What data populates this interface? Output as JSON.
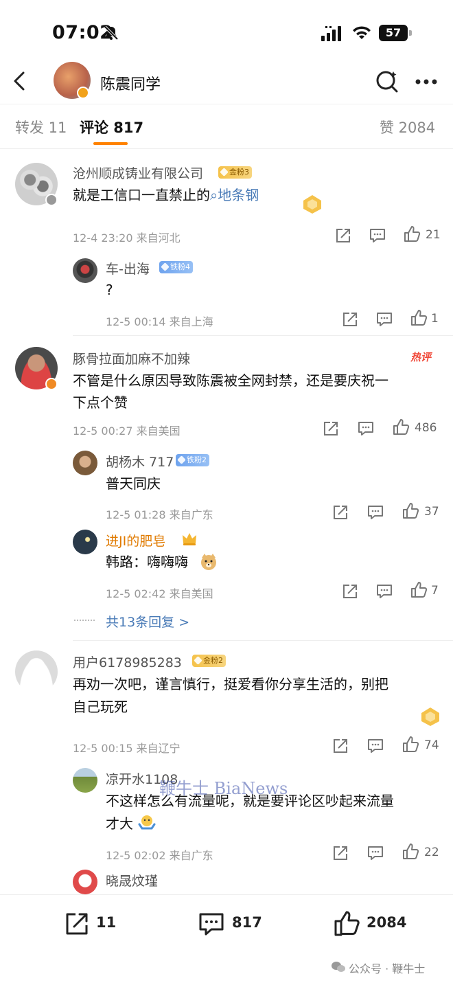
{
  "status_bar": {
    "time": "07:02",
    "battery": "57"
  },
  "header": {
    "title": "陈震同学"
  },
  "tabs": {
    "repost": "转发 11",
    "comments": "评论 817",
    "likes": "赞 2084"
  },
  "comments": [
    {
      "user": "沧州顺成铸业有限公司",
      "fan_badge": "金粉3",
      "text_before": "就是工信口一直禁止的",
      "text_link": "地条钢",
      "meta": "12-4 23:20  来自河北",
      "likes": "21",
      "replies": [
        {
          "user": "车-出海",
          "fan_badge": "铁粉4",
          "text": "?",
          "meta": "12-5 00:14  来自上海",
          "likes": "1"
        }
      ]
    },
    {
      "user": "豚骨拉面加麻不加辣",
      "hot_label": "热评",
      "text_line1": "不管是什么原因导致陈震被全网封禁，还是要庆祝一",
      "text_line2": "下点个赞",
      "meta": "12-5 00:27  来自美国",
      "likes": "486",
      "replies": [
        {
          "user": "胡杨木 717",
          "fan_badge": "铁粉2",
          "text": "普天同庆",
          "meta": "12-5 01:28  来自广东",
          "likes": "37"
        },
        {
          "user": "进JI的肥皂",
          "text": "韩路：嗨嗨嗨",
          "meta": "12-5 02:42  来自美国",
          "likes": "7"
        }
      ],
      "more_replies": "共13条回复 >"
    },
    {
      "user": "用户6178985283",
      "fan_badge": "金粉2",
      "text_line1": "再劝一次吧，谨言慎行，挺爱看你分享生活的，别把",
      "text_line2": "自己玩死",
      "meta": "12-5 00:15  来自辽宁",
      "likes": "74",
      "replies": [
        {
          "user": "凉开水1108",
          "text_line1": "不这样怎么有流量呢，就是要评论区吵起来流量",
          "text_line2": "才大",
          "meta": "12-5 02:02  来自广东",
          "likes": "22"
        },
        {
          "user": "晓晟炆瑾"
        }
      ]
    }
  ],
  "bottom_bar": {
    "repost_count": "11",
    "comment_count": "817",
    "like_count": "2084"
  },
  "watermarks": {
    "overlay": "鞭牛士 BiaNews",
    "wechat": "公众号 · 鞭牛士"
  },
  "colors": {
    "accent": "#ff8200",
    "link": "#4a7bb7",
    "hot": "#f04a3a"
  }
}
